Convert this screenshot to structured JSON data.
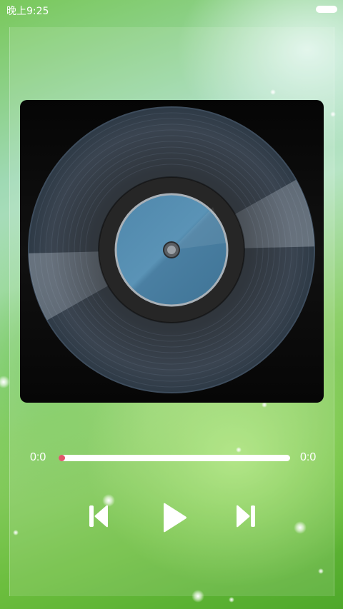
{
  "status_bar": {
    "time": "晚上9:25",
    "battery_icon": "battery-icon"
  },
  "album": {
    "art_icon": "vinyl-record-icon"
  },
  "progress": {
    "current_time": "0:0",
    "total_time": "0:0",
    "fraction": 0.0,
    "track_color": "#ffffff",
    "thumb_color": "#e0566a"
  },
  "controls": {
    "previous_icon": "skip-previous-icon",
    "play_icon": "play-icon",
    "next_icon": "skip-next-icon"
  },
  "colors": {
    "background_accent": "#6cbe3e",
    "label_blue": "#4d84a6"
  }
}
